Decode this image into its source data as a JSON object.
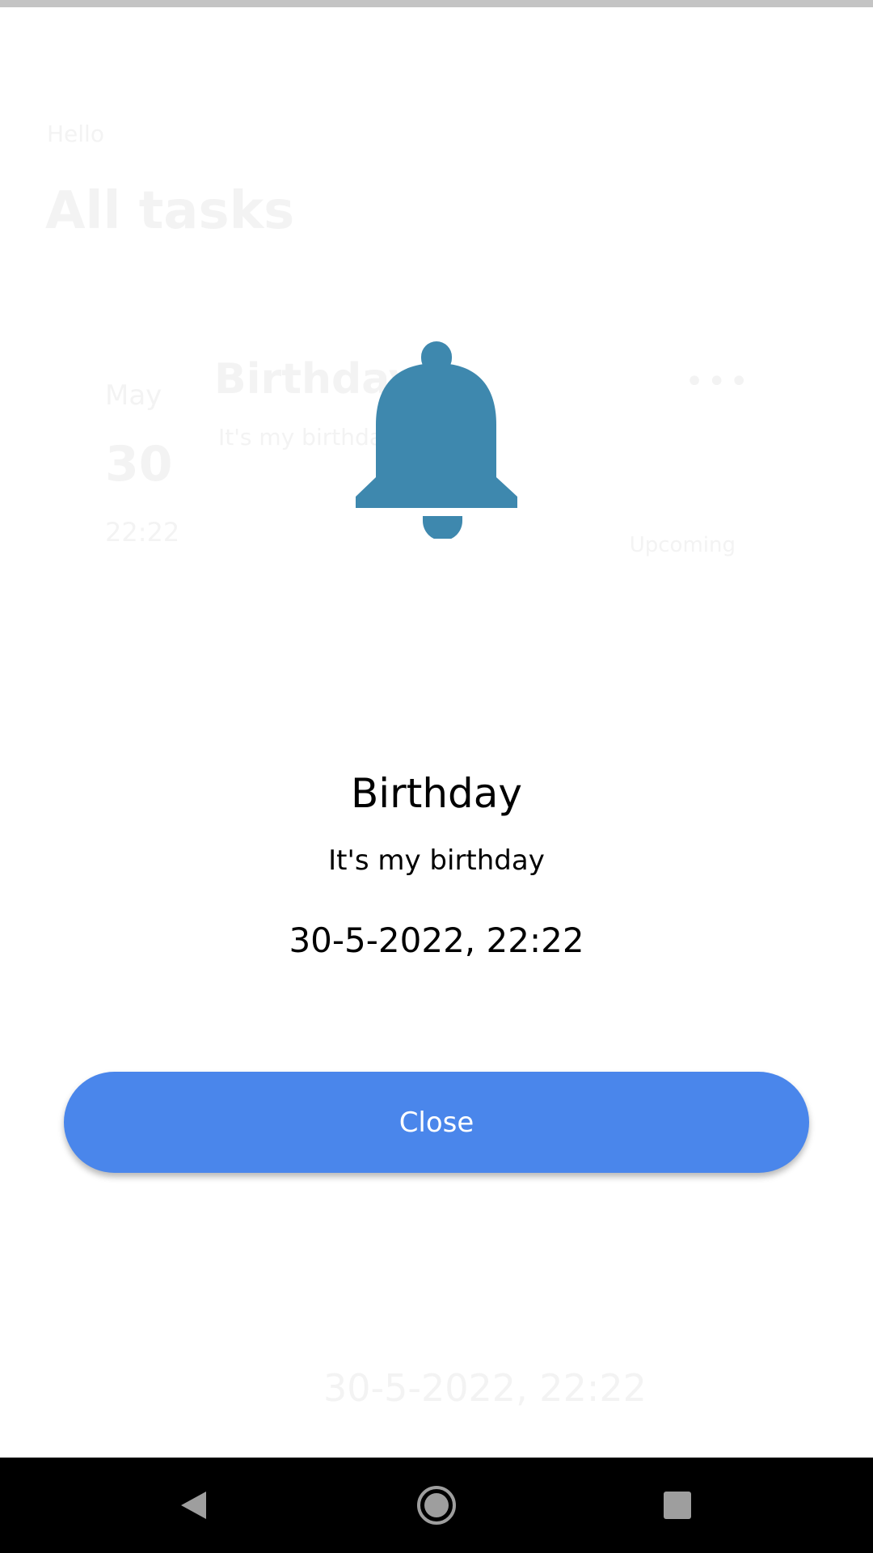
{
  "background": {
    "small_label": "Hello",
    "page_title": "All tasks",
    "card": {
      "month": "May",
      "day": "30",
      "title": "Birthday",
      "description": "It's my birthday",
      "time": "22:22",
      "more": "•••",
      "status": "Upcoming"
    },
    "bottom_date": "30-5-2022, 22:22"
  },
  "dialog": {
    "icon": "bell-icon",
    "title": "Birthday",
    "message": "It's my birthday",
    "datetime": "30-5-2022, 22:22",
    "close_label": "Close"
  },
  "colors": {
    "bell": "#3e88ae",
    "button": "#4a86eb",
    "nav_bar": "#000000",
    "status_bar": "#c4c4c4"
  },
  "nav": {
    "back_icon": "back-triangle-icon",
    "home_icon": "home-circle-icon",
    "recents_icon": "recents-square-icon"
  }
}
